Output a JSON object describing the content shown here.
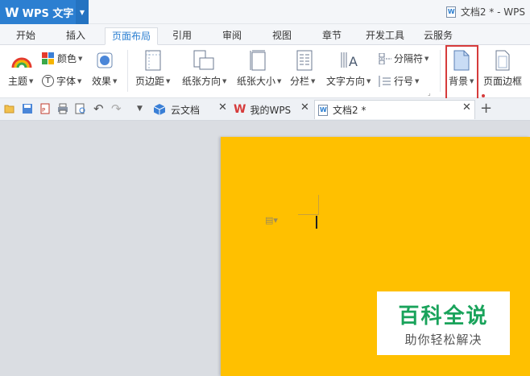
{
  "titlebar": {
    "app_name": "WPS 文字",
    "window_title": "文档2 * - WPS"
  },
  "menu": {
    "tabs": [
      "开始",
      "插入",
      "页面布局",
      "引用",
      "审阅",
      "视图",
      "章节",
      "开发工具",
      "云服务"
    ],
    "active_index": 2
  },
  "ribbon": {
    "color_label": "颜色",
    "theme_label": "主题",
    "font_label": "字体",
    "effect_label": "效果",
    "margins_label": "页边距",
    "orientation_label": "纸张方向",
    "size_label": "纸张大小",
    "columns_label": "分栏",
    "text_direction_label": "文字方向",
    "separator_label": "分隔符",
    "line_number_label": "行号",
    "background_label": "背景",
    "page_border_label": "页面边框"
  },
  "doc_tabs": {
    "cloud_docs": "云文档",
    "my_wps": "我的WPS",
    "doc2": "文档2 *"
  },
  "watermark": {
    "title": "百科全说",
    "subtitle": "助你轻松解决"
  },
  "colors": {
    "accent": "#2c7fd1",
    "page_background": "#ffc000",
    "highlight": "#d63b3b"
  }
}
